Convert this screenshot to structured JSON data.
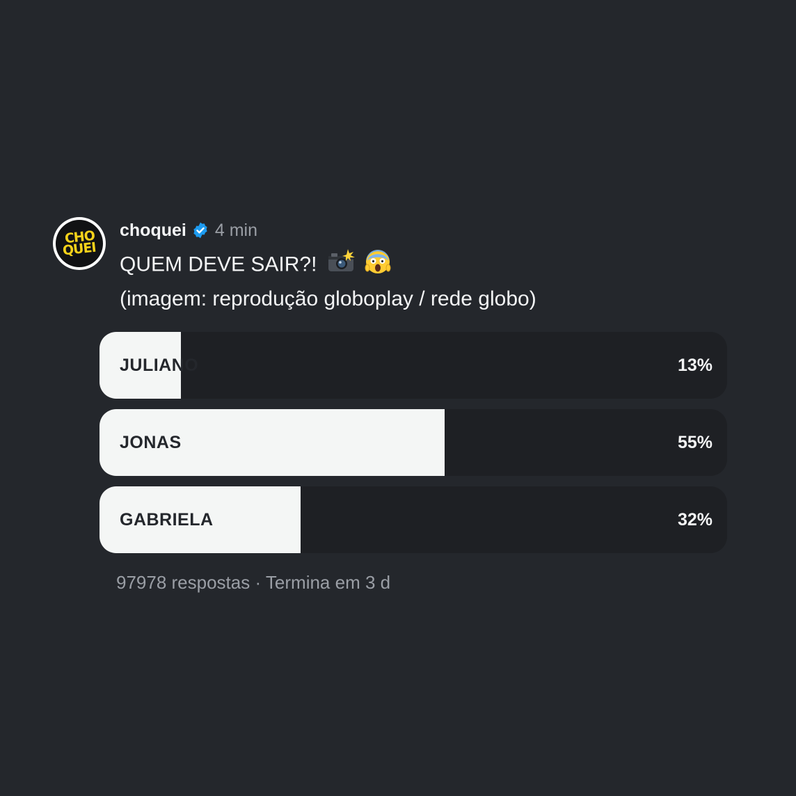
{
  "post": {
    "avatar_text_top": "CHO",
    "avatar_text_bottom": "QUEI",
    "username": "choquei",
    "time": "4 min",
    "caption_line1": "QUEM DEVE SAIR?!",
    "caption_emoji1": "📸",
    "caption_emoji2": "😱",
    "caption_line2": "(imagem: reprodução globoplay / rede globo)"
  },
  "poll": {
    "options": [
      {
        "label": "JULIANO",
        "percent_text": "13%",
        "percent": 13
      },
      {
        "label": "JONAS",
        "percent_text": "55%",
        "percent": 55
      },
      {
        "label": "GABRIELA",
        "percent_text": "32%",
        "percent": 32
      }
    ],
    "responses": "97978 respostas",
    "separator": "·",
    "ends": "Termina em 3 d"
  },
  "colors": {
    "background": "#24272c",
    "bar_track": "#1e2024",
    "bar_fill": "#f4f6f5",
    "verified_badge": "#1d9bf0",
    "avatar_text": "#f5d21a",
    "muted_text": "#9a9ea5"
  }
}
